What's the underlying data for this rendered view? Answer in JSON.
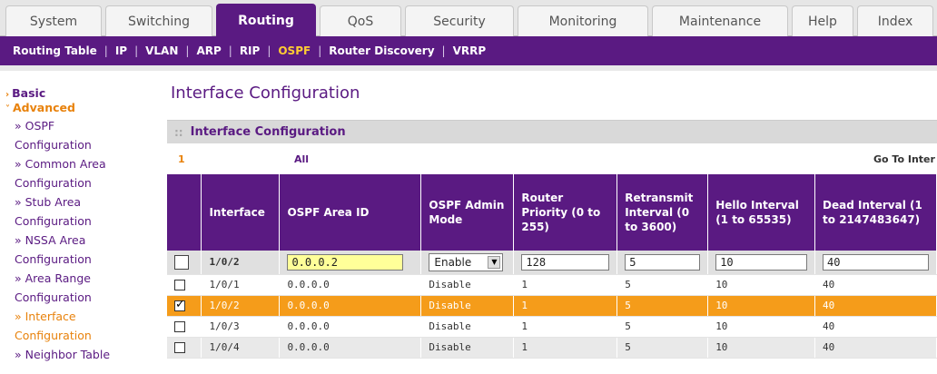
{
  "tabs": [
    {
      "label": "System",
      "active": false
    },
    {
      "label": "Switching",
      "active": false
    },
    {
      "label": "Routing",
      "active": true
    },
    {
      "label": "QoS",
      "active": false
    },
    {
      "label": "Security",
      "active": false
    },
    {
      "label": "Monitoring",
      "active": false
    },
    {
      "label": "Maintenance",
      "active": false
    },
    {
      "label": "Help",
      "active": false
    },
    {
      "label": "Index",
      "active": false
    }
  ],
  "subnav": [
    {
      "label": "Routing Table",
      "active": false
    },
    {
      "label": "IP",
      "active": false
    },
    {
      "label": "VLAN",
      "active": false
    },
    {
      "label": "ARP",
      "active": false
    },
    {
      "label": "RIP",
      "active": false
    },
    {
      "label": "OSPF",
      "active": true
    },
    {
      "label": "Router Discovery",
      "active": false
    },
    {
      "label": "VRRP",
      "active": false
    }
  ],
  "leftnav": {
    "basic": "Basic",
    "advanced": "Advanced",
    "items": [
      {
        "line1": "» OSPF",
        "line2": "Configuration"
      },
      {
        "line1": "» Common Area",
        "line2": "Configuration"
      },
      {
        "line1": "» Stub Area",
        "line2": "Configuration"
      },
      {
        "line1": "» NSSA Area",
        "line2": "Configuration"
      },
      {
        "line1": "» Area Range",
        "line2": "Configuration"
      },
      {
        "line1": "» Interface",
        "line2": "Configuration"
      },
      {
        "line1": "» Neighbor Table",
        "line2": ""
      }
    ]
  },
  "page_title": "Interface Configuration",
  "panel": {
    "title": "Interface Configuration",
    "dots": "::",
    "page_num": "1",
    "all_label": "All",
    "goto_label": "Go To Inter"
  },
  "table": {
    "headers": [
      "Interface",
      "OSPF Area ID",
      "OSPF Admin Mode",
      "Router Priority (0 to 255)",
      "Retransmit Interval (0 to 3600)",
      "Hello Interval (1 to 65535)",
      "Dead Interval (1 to 2147483647)"
    ],
    "edit_row": {
      "interface": "1/0/2",
      "area_id": "0.0.0.2",
      "admin_mode": "Enable",
      "priority": "128",
      "retransmit": "5",
      "hello": "10",
      "dead": "40"
    },
    "rows": [
      {
        "checked": false,
        "interface": "1/0/1",
        "area_id": "0.0.0.0",
        "admin_mode": "Disable",
        "priority": "1",
        "retransmit": "5",
        "hello": "10",
        "dead": "40"
      },
      {
        "checked": true,
        "interface": "1/0/2",
        "area_id": "0.0.0.0",
        "admin_mode": "Disable",
        "priority": "1",
        "retransmit": "5",
        "hello": "10",
        "dead": "40"
      },
      {
        "checked": false,
        "interface": "1/0/3",
        "area_id": "0.0.0.0",
        "admin_mode": "Disable",
        "priority": "1",
        "retransmit": "5",
        "hello": "10",
        "dead": "40"
      },
      {
        "checked": false,
        "interface": "1/0/4",
        "area_id": "0.0.0.0",
        "admin_mode": "Disable",
        "priority": "1",
        "retransmit": "5",
        "hello": "10",
        "dead": "40"
      }
    ]
  },
  "colors": {
    "brand_purple": "#5a1a82",
    "accent_orange": "#f59c1a",
    "active_link": "#ffcc33"
  }
}
